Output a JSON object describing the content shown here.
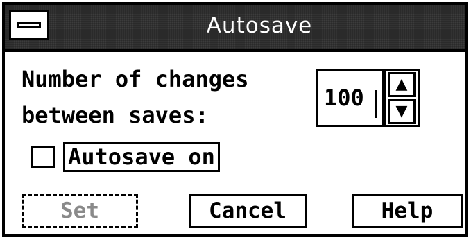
{
  "dialog": {
    "title": "Autosave",
    "system_menu_icon": "system-menu-icon",
    "changes_label_line1": "Number of changes",
    "changes_label_line2": "between saves:",
    "changes_value": "100",
    "spin_up_icon": "arrow-up-icon",
    "spin_down_icon": "arrow-down-icon",
    "autosave_checkbox_label": "Autosave on",
    "autosave_checked": false,
    "set_label": "Set",
    "set_enabled": false,
    "cancel_label": "Cancel",
    "help_label": "Help"
  }
}
